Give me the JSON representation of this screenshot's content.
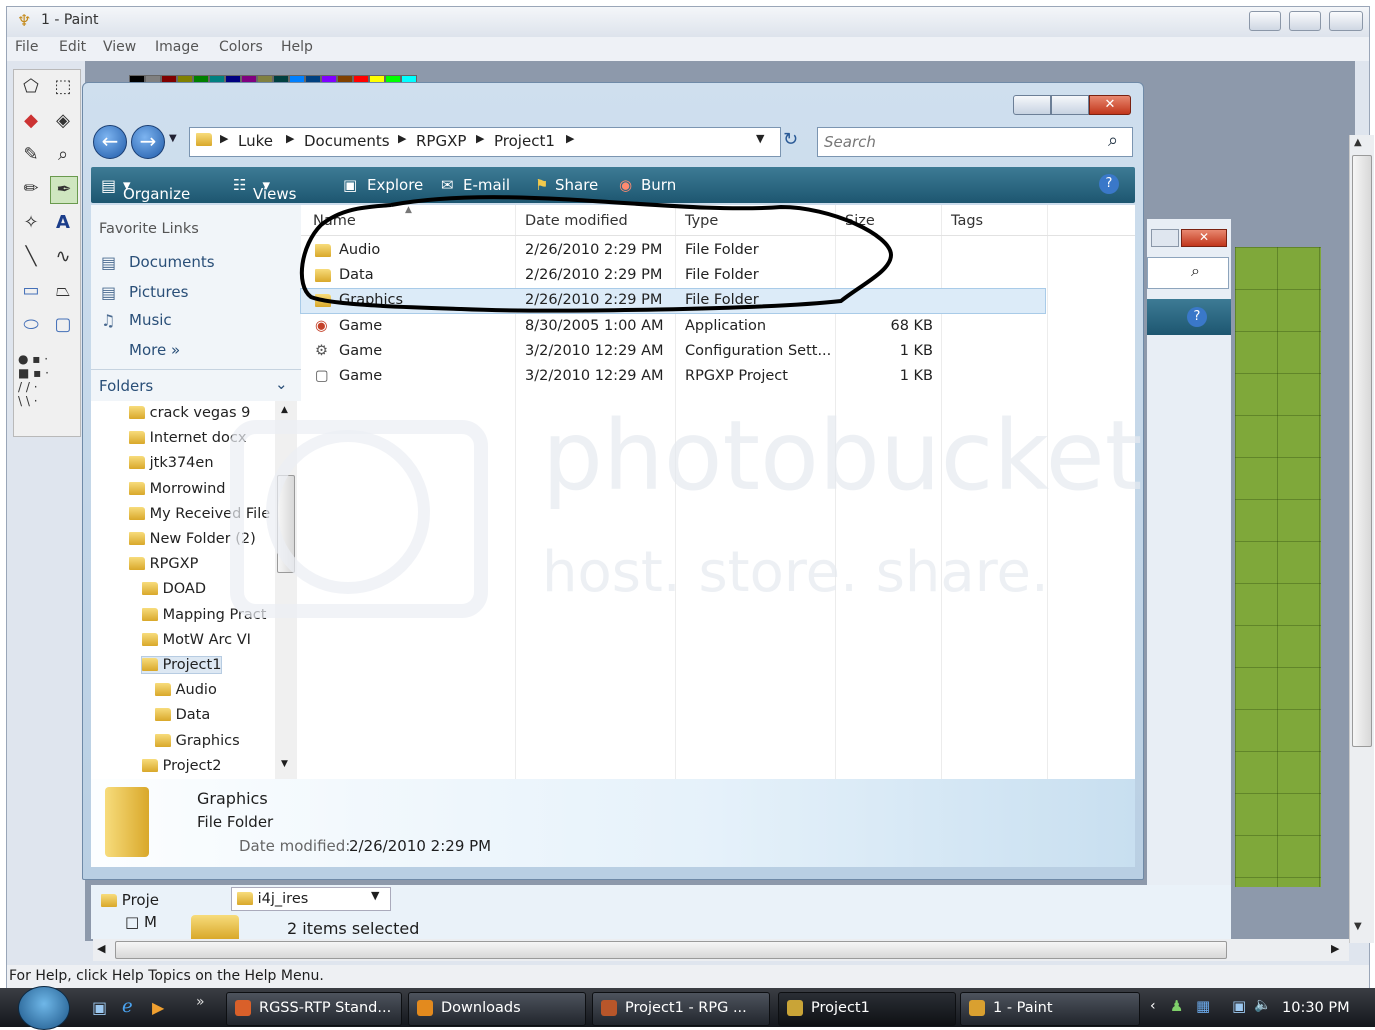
{
  "paint": {
    "title": "1 - Paint",
    "menu": [
      "File",
      "Edit",
      "View",
      "Image",
      "Colors",
      "Help"
    ],
    "status": "For Help, click Help Topics on the Help Menu.",
    "palette": [
      "#000000",
      "#808080",
      "#800000",
      "#808000",
      "#008000",
      "#008080",
      "#000080",
      "#800080",
      "#808040",
      "#004040",
      "#0080ff",
      "#004080",
      "#8000ff",
      "#804000",
      "#ff0000",
      "#ffff00",
      "#00ff00",
      "#00ffff",
      "#0000ff",
      "#ff00ff"
    ]
  },
  "explorer": {
    "breadcrumb": [
      "Luke",
      "Documents",
      "RPGXP",
      "Project1"
    ],
    "search_placeholder": "Search",
    "toolbar": {
      "organize": "Organize",
      "views": "Views",
      "explore": "Explore",
      "email": "E-mail",
      "share": "Share",
      "burn": "Burn"
    },
    "favorite_links_title": "Favorite Links",
    "favorite_links": [
      "Documents",
      "Pictures",
      "Music"
    ],
    "more": "More",
    "folders_title": "Folders",
    "tree": [
      {
        "label": "crack vegas 9",
        "indent": 0
      },
      {
        "label": "Internet docx",
        "indent": 0
      },
      {
        "label": "jtk374en",
        "indent": 0
      },
      {
        "label": "Morrowind",
        "indent": 0
      },
      {
        "label": "My Received File",
        "indent": 0
      },
      {
        "label": "New Folder (2)",
        "indent": 0
      },
      {
        "label": "RPGXP",
        "indent": 0
      },
      {
        "label": "DOAD",
        "indent": 1
      },
      {
        "label": "Mapping Pract",
        "indent": 1
      },
      {
        "label": "MotW Arc VI",
        "indent": 1
      },
      {
        "label": "Project1",
        "indent": 1
      },
      {
        "label": "Audio",
        "indent": 2
      },
      {
        "label": "Data",
        "indent": 2
      },
      {
        "label": "Graphics",
        "indent": 2
      },
      {
        "label": "Project2",
        "indent": 1
      }
    ],
    "columns": [
      "Name",
      "Date modified",
      "Type",
      "Size",
      "Tags"
    ],
    "files": [
      {
        "name": "Audio",
        "date": "2/26/2010 2:29 PM",
        "type": "File Folder",
        "size": "",
        "icon": "folder"
      },
      {
        "name": "Data",
        "date": "2/26/2010 2:29 PM",
        "type": "File Folder",
        "size": "",
        "icon": "folder"
      },
      {
        "name": "Graphics",
        "date": "2/26/2010 2:29 PM",
        "type": "File Folder",
        "size": "",
        "icon": "folder"
      },
      {
        "name": "Game",
        "date": "8/30/2005 1:00 AM",
        "type": "Application",
        "size": "68 KB",
        "icon": "app"
      },
      {
        "name": "Game",
        "date": "3/2/2010 12:29 AM",
        "type": "Configuration Sett...",
        "size": "1 KB",
        "icon": "config"
      },
      {
        "name": "Game",
        "date": "3/2/2010 12:29 AM",
        "type": "RPGXP Project",
        "size": "1 KB",
        "icon": "project"
      }
    ],
    "details": {
      "name": "Graphics",
      "kind": "File Folder",
      "modified_label": "Date modified:",
      "modified_value": "2/26/2010 2:29 PM"
    }
  },
  "back_window": {
    "tree_item": "Proje",
    "tree_item2": "M",
    "dropdown": "i4j_ires",
    "status": "2 items selected"
  },
  "watermark": {
    "line1": "photobucket",
    "line2": "host. store. share."
  },
  "taskbar": {
    "items": [
      {
        "label": "RGSS-RTP Stand...",
        "color": "#d9602a"
      },
      {
        "label": "Downloads",
        "color": "#e38a1e"
      },
      {
        "label": "Project1 - RPG ...",
        "color": "#b8562a"
      },
      {
        "label": "Project1",
        "color": "#c9a437"
      },
      {
        "label": "1 - Paint",
        "color": "#d9a030"
      }
    ],
    "clock": "10:30 PM"
  }
}
